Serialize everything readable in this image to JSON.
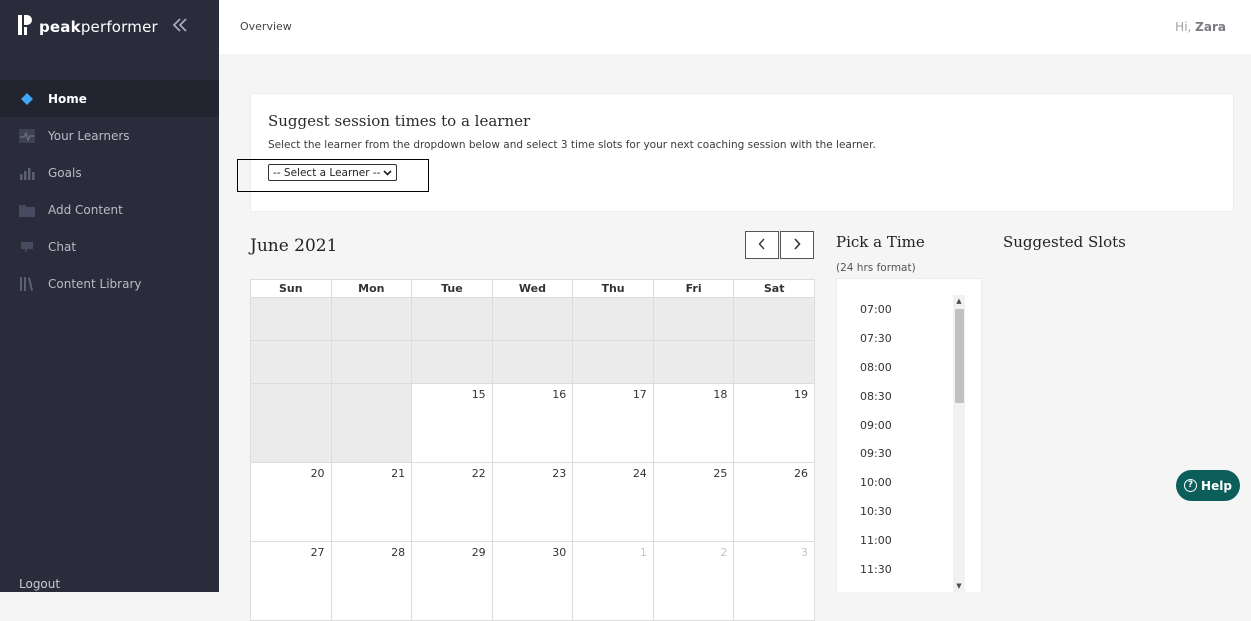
{
  "brand": {
    "name_bold": "peak",
    "name_rest": "performer"
  },
  "sidebar": {
    "items": [
      {
        "label": "Home",
        "icon": "diamond-icon",
        "active": true
      },
      {
        "label": "Your Learners",
        "icon": "activity-chart-icon"
      },
      {
        "label": "Goals",
        "icon": "bar-chart-icon"
      },
      {
        "label": "Add Content",
        "icon": "folder-icon"
      },
      {
        "label": "Chat",
        "icon": "chat-icon"
      },
      {
        "label": "Content Library",
        "icon": "library-icon"
      }
    ],
    "logout": "Logout"
  },
  "topbar": {
    "breadcrumb": "Overview",
    "greeting_prefix": "Hi,",
    "user_name": "Zara"
  },
  "suggest": {
    "title": "Suggest session times to a learner",
    "description": "Select the learner from the dropdown below and select 3 time slots for your next coaching session with the learner.",
    "select_value": "-- Select a Learner --"
  },
  "calendar": {
    "month": "June 2021",
    "weekdays": [
      "Sun",
      "Mon",
      "Tue",
      "Wed",
      "Thu",
      "Fri",
      "Sat"
    ],
    "weeks": [
      [
        "",
        "",
        "",
        "",
        "",
        "",
        ""
      ],
      [
        "",
        "",
        "",
        "",
        "",
        "",
        ""
      ],
      [
        "",
        "",
        "15",
        "16",
        "17",
        "18",
        "19"
      ],
      [
        "20",
        "21",
        "22",
        "23",
        "24",
        "25",
        "26"
      ],
      [
        "27",
        "28",
        "29",
        "30",
        "1",
        "2",
        "3"
      ]
    ]
  },
  "pick_time": {
    "title": "Pick a Time",
    "subtitle": "(24 hrs format)",
    "times": [
      "07:00",
      "07:30",
      "08:00",
      "08:30",
      "09:00",
      "09:30",
      "10:00",
      "10:30",
      "11:00",
      "11:30"
    ]
  },
  "suggested_slots": {
    "title": "Suggested Slots"
  },
  "help": {
    "label": "Help"
  },
  "colors": {
    "sidebar_bg": "#2a2c3c",
    "active_icon": "#3fa9f5",
    "help_bg": "#0b5e5a"
  }
}
